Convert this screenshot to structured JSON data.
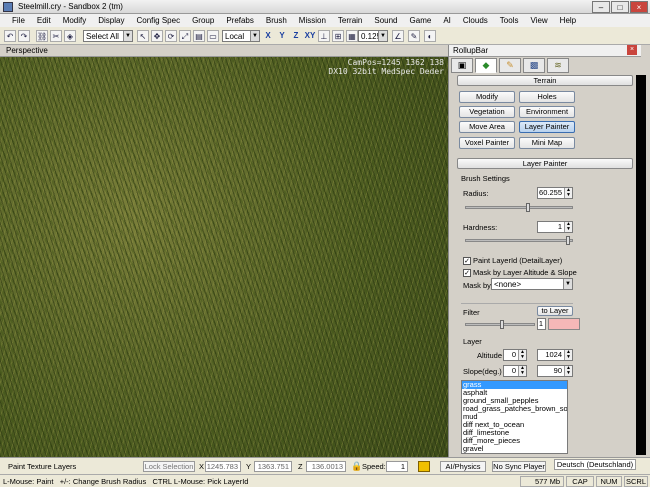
{
  "window": {
    "title": "Steelmill.cry - Sandbox 2 (tm)",
    "min": "–",
    "max": "□",
    "close": "×"
  },
  "menu": [
    "File",
    "Edit",
    "Modify",
    "Display",
    "Config Spec",
    "Group",
    "Prefabs",
    "Brush",
    "Mission",
    "Terrain",
    "Sound",
    "Game",
    "AI",
    "Clouds",
    "Tools",
    "View",
    "Help"
  ],
  "toolbar": {
    "selection": "Select All",
    "coord_system": "Local",
    "axes": [
      "X",
      "Y",
      "Z",
      "XY"
    ],
    "snap_value": "0.125"
  },
  "viewport": {
    "label": "Perspective",
    "info_line1": "CamPos=1245 1362 138",
    "info_line2": "DX10 32bit MedSpec Deder"
  },
  "rollup": {
    "title": "RollupBar",
    "close": "×",
    "tabs": [
      "obj",
      "terrain",
      "model",
      "display",
      "layer"
    ],
    "terrain_section": "Terrain",
    "tools": [
      {
        "label": "Modify",
        "active": false
      },
      {
        "label": "Holes",
        "active": false
      },
      {
        "label": "Vegetation",
        "active": false
      },
      {
        "label": "Environment",
        "active": false
      },
      {
        "label": "Move Area",
        "active": false
      },
      {
        "label": "Layer Painter",
        "active": true
      },
      {
        "label": "Voxel Painter",
        "active": false
      },
      {
        "label": "Mini Map",
        "active": false
      }
    ],
    "layer_painter_section": "Layer Painter",
    "brush_settings": "Brush Settings",
    "radius_label": "Radius:",
    "radius_value": "60.255",
    "radius_fraction": 0.6,
    "hardness_label": "Hardness:",
    "hardness_value": "1",
    "hardness_fraction": 1.0,
    "paint_layerid": "Paint LayerId (DetailLayer)",
    "mask_by_layer": "Mask by Layer Altitude & Slope",
    "mask_by_label": "Mask by",
    "mask_by_value": "<none>",
    "filter_label": "Filter",
    "to_layer": "to Layer",
    "filter_value": "1",
    "filter_fraction": 0.55,
    "filter_color": "#f5b8b8",
    "layer_label": "Layer",
    "altitude_label": "Altitude",
    "altitude_min": "0",
    "altitude_max": "1024",
    "slope_label": "Slope(deg.)",
    "slope_min": "0",
    "slope_max": "90",
    "layers": [
      "grass",
      "asphalt",
      "ground_small_pepples",
      "road_grass_patches_brown_soil",
      "mud",
      "diff next_to_ocean",
      "diff_limestone",
      "diff_more_pieces",
      "gravel"
    ],
    "selected_layer_index": 0
  },
  "status": {
    "mode": "Paint Texture Layers",
    "lock_selection": "Lock Selection",
    "x_label": "X",
    "x_value": "1245.783",
    "y_label": "Y",
    "y_value": "1363.751",
    "z_label": "Z",
    "z_value": "136.0013",
    "speed_label": "Speed:",
    "speed_value": "1",
    "ai_physics": "AI/Physics",
    "no_sync": "No Sync Player",
    "language": "Deutsch (Deutschland)",
    "hint": "L-Mouse: Paint   +/-: Change Brush Radius   CTRL L-Mouse: Pick LayerId",
    "memory": "577 Mb",
    "cap": "CAP",
    "num": "NUM",
    "scrl": "SCRL"
  }
}
